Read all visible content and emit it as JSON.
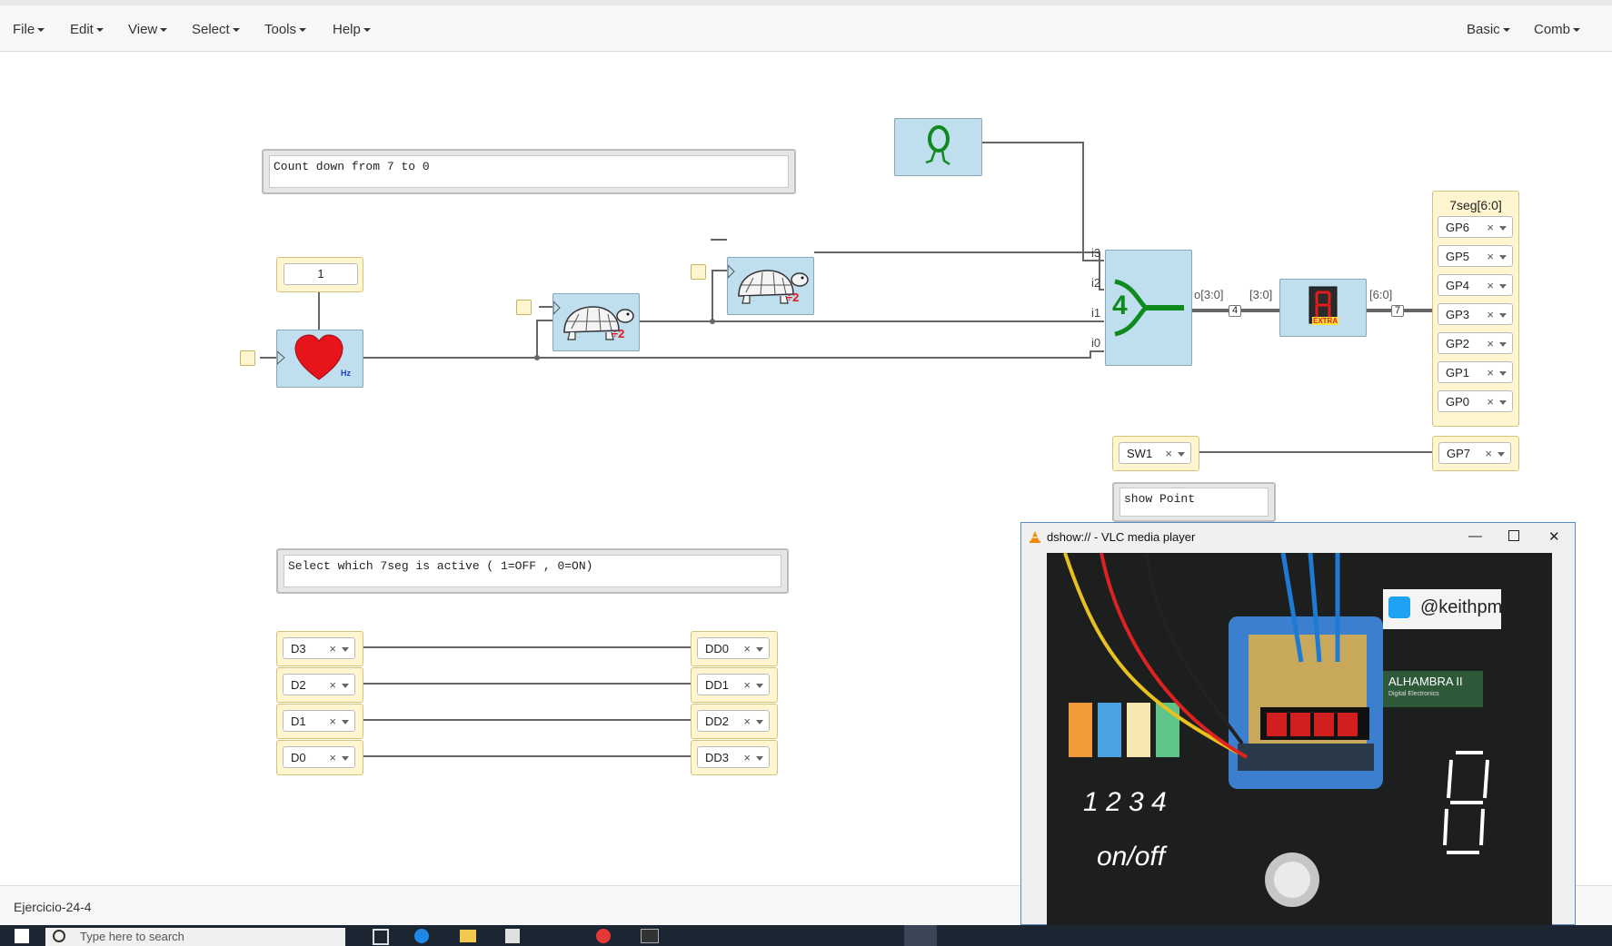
{
  "menubar": {
    "items": [
      "File",
      "Edit",
      "View",
      "Select",
      "Tools",
      "Help"
    ],
    "right_items": [
      "Basic",
      "Comb"
    ]
  },
  "canvas": {
    "info_countdown": "Count down from 7 to 0",
    "info_select": "Select which 7seg is active ( 1=OFF , 0=ON)",
    "info_show_point": "show Point",
    "constant_value": "1",
    "heart_label": "Hz",
    "divider_label": "÷2",
    "mux_label": "4",
    "mux_ports": [
      "i3",
      "i2",
      "i1",
      "i0"
    ],
    "mux_out": "o[3:0]",
    "bus_in_label": "[3:0]",
    "bus_in_width": "4",
    "bus_out_label": "[6:0]",
    "bus_out_width": "7",
    "seg_block_label": "EXTRA",
    "output_group_title": "7seg[6:0]",
    "gp_pins": [
      "GP6",
      "GP5",
      "GP4",
      "GP3",
      "GP2",
      "GP1",
      "GP0"
    ],
    "sw_input": "SW1",
    "gp7": "GP7",
    "d_inputs": [
      "D3",
      "D2",
      "D1",
      "D0"
    ],
    "dd_outputs": [
      "DD0",
      "DD1",
      "DD2",
      "DD3"
    ],
    "x_glyph": "×"
  },
  "statusbar": {
    "project_name": "Ejercicio-24-4"
  },
  "vlc": {
    "title": "dshow:// - VLC media player",
    "twitter": "@keithpmt",
    "board_label": "ALHAMBRA II",
    "board_sub": "Digital Electronics",
    "switch_numbers": "1 2 3 4",
    "onoff": "on/off"
  },
  "taskbar": {
    "search_placeholder": "Type here to search"
  },
  "colors": {
    "block": "#bfdfee",
    "io": "#fff6d0",
    "wire": "#666666",
    "heart": "#e8141b",
    "mux": "#0f8a1e"
  }
}
